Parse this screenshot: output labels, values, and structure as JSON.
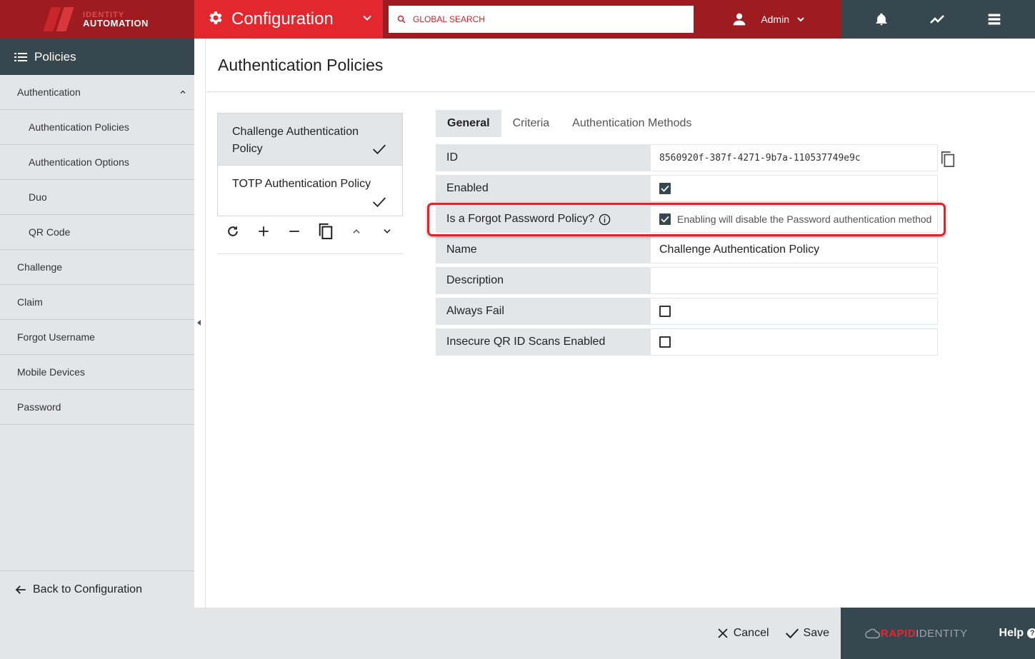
{
  "brand": {
    "line1": "IDENTITY",
    "line2": "AUTOMATION"
  },
  "header": {
    "module_title": "Configuration",
    "search_placeholder": "GLOBAL SEARCH",
    "user_name": "Admin"
  },
  "sidebar": {
    "title": "Policies",
    "items": [
      {
        "label": "Authentication",
        "level": 0
      },
      {
        "label": "Authentication Policies",
        "level": 1
      },
      {
        "label": "Authentication Options",
        "level": 1
      },
      {
        "label": "Duo",
        "level": 1
      },
      {
        "label": "QR Code",
        "level": 1
      },
      {
        "label": "Challenge",
        "level": 0
      },
      {
        "label": "Claim",
        "level": 0
      },
      {
        "label": "Forgot Username",
        "level": 0
      },
      {
        "label": "Mobile Devices",
        "level": 0
      },
      {
        "label": "Password",
        "level": 0
      }
    ],
    "back_label": "Back to Configuration"
  },
  "main": {
    "page_title": "Authentication Policies",
    "policies": [
      {
        "label": "Challenge Authentication Policy",
        "selected": true
      },
      {
        "label": "TOTP Authentication Policy",
        "selected": false
      }
    ],
    "tabs": [
      {
        "label": "General",
        "active": true
      },
      {
        "label": "Criteria",
        "active": false
      },
      {
        "label": "Authentication Methods",
        "active": false
      }
    ],
    "form": {
      "id": {
        "label": "ID",
        "value": "8560920f-387f-4271-9b7a-110537749e9c"
      },
      "enabled": {
        "label": "Enabled",
        "checked": true
      },
      "forgot": {
        "label": "Is a Forgot Password Policy?",
        "checked": true,
        "hint": "Enabling will disable the Password authentication method"
      },
      "name": {
        "label": "Name",
        "value": "Challenge Authentication Policy"
      },
      "description": {
        "label": "Description",
        "value": ""
      },
      "always_fail": {
        "label": "Always Fail",
        "checked": false
      },
      "insecure_qr": {
        "label": "Insecure QR ID Scans Enabled",
        "checked": false
      }
    }
  },
  "footer": {
    "cancel_label": "Cancel",
    "save_label": "Save",
    "product_rapid": "RAPID",
    "product_identity": "IDENTITY",
    "help_label": "Help"
  },
  "colors": {
    "brand_red": "#e2282e",
    "dark_red": "#9e1b1f",
    "slate": "#37474f",
    "panel_gray": "#e3e6e8"
  }
}
